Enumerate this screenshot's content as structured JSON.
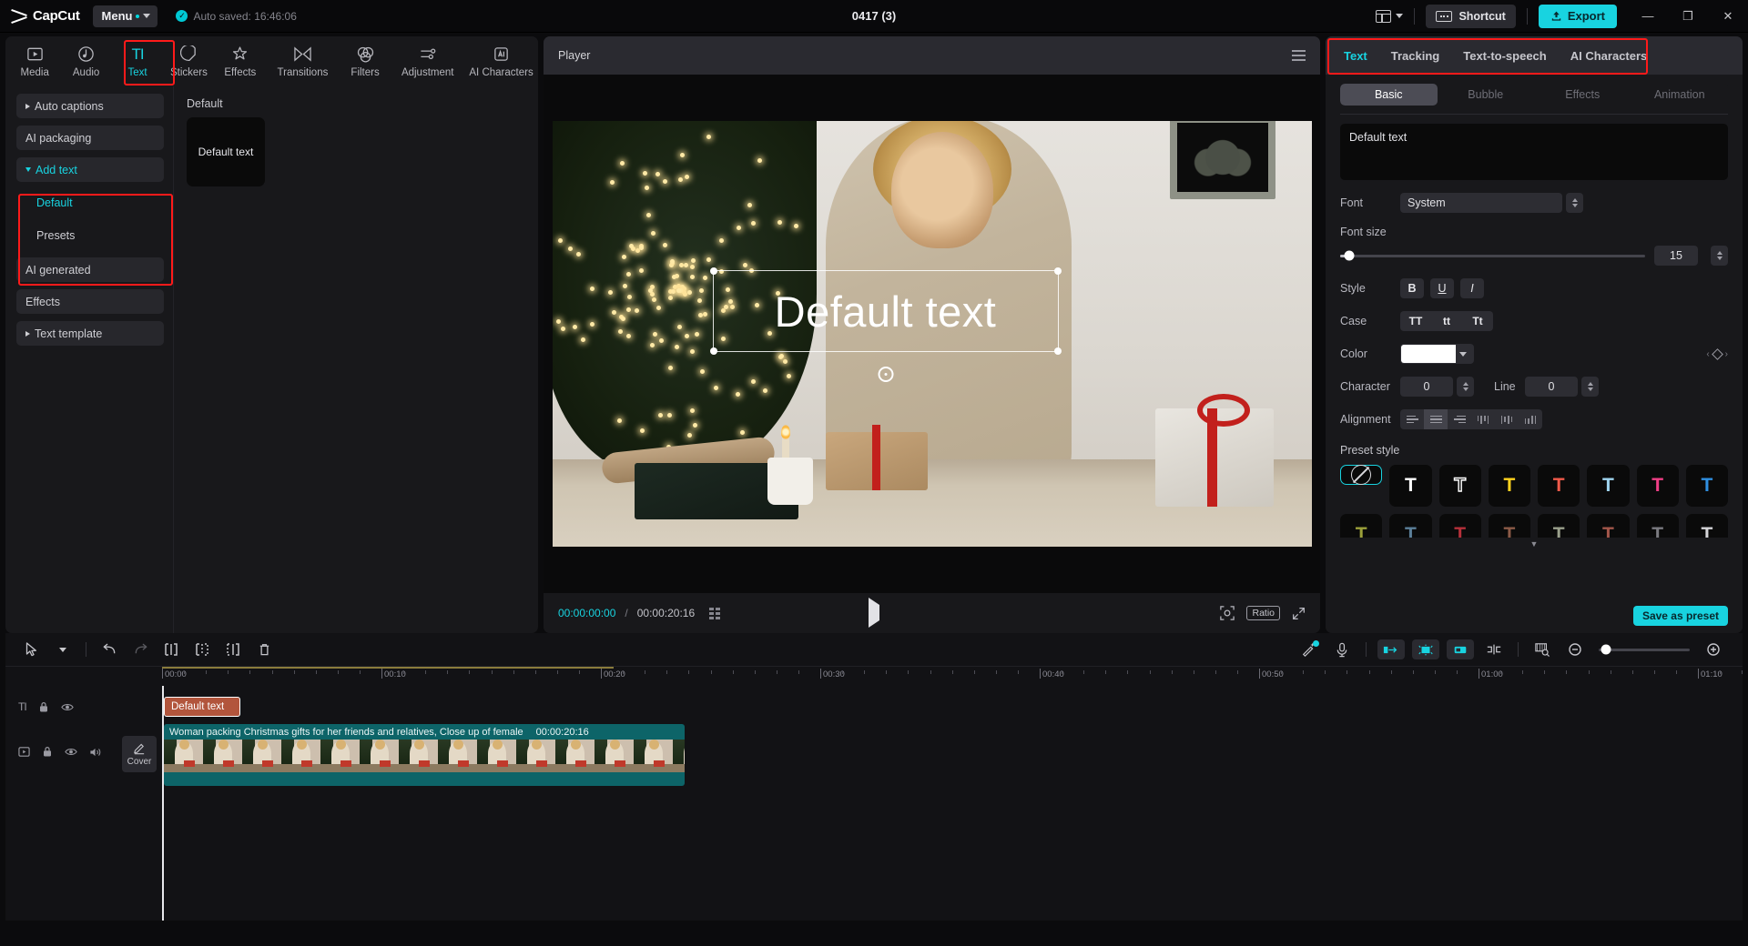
{
  "topbar": {
    "brand": "CapCut",
    "menu_label": "Menu",
    "autosave_text": "Auto saved: 16:46:06",
    "project_title": "0417 (3)",
    "shortcut_label": "Shortcut",
    "export_label": "Export",
    "layout_icon": "layout-icon",
    "minimize_icon": "minimize-icon",
    "maximize_icon": "maximize-icon",
    "close_icon": "close-icon"
  },
  "nav_tabs": [
    {
      "label": "Media",
      "icon": "media-icon",
      "active": false
    },
    {
      "label": "Audio",
      "icon": "audio-icon",
      "active": false
    },
    {
      "label": "Text",
      "icon": "text-icon",
      "active": true
    },
    {
      "label": "Stickers",
      "icon": "stickers-icon",
      "active": false
    },
    {
      "label": "Effects",
      "icon": "effects-icon",
      "active": false
    },
    {
      "label": "Transitions",
      "icon": "transitions-icon",
      "active": false
    },
    {
      "label": "Filters",
      "icon": "filters-icon",
      "active": false
    },
    {
      "label": "Adjustment",
      "icon": "adjustment-icon",
      "active": false
    },
    {
      "label": "AI Characters",
      "icon": "ai-characters-icon",
      "active": false
    }
  ],
  "sidebar": {
    "items": [
      {
        "label": "Auto captions",
        "expandable": true,
        "expanded": false,
        "active": false
      },
      {
        "label": "AI packaging",
        "expandable": false,
        "expanded": false,
        "active": false
      },
      {
        "label": "Add text",
        "expandable": true,
        "expanded": true,
        "active": true
      },
      {
        "label": "AI generated",
        "expandable": false,
        "expanded": false,
        "active": false
      },
      {
        "label": "Effects",
        "expandable": false,
        "expanded": false,
        "active": false
      },
      {
        "label": "Text template",
        "expandable": true,
        "expanded": false,
        "active": false
      }
    ],
    "add_text_children": [
      {
        "label": "Default",
        "active": true
      },
      {
        "label": "Presets",
        "active": false
      }
    ]
  },
  "content_pane": {
    "group_label": "Default",
    "card_label": "Default text"
  },
  "player": {
    "title": "Player",
    "menu_icon": "hamburger-icon",
    "canvas_text": "Default text",
    "current_time": "00:00:00:00",
    "time_separator": "/",
    "total_time": "00:00:20:16",
    "grid_icon": "grid-icon",
    "play_icon": "play-icon",
    "zoom_icon": "zoom-fit-icon",
    "ratio_label": "Ratio",
    "fullscreen_icon": "fullscreen-icon"
  },
  "inspector": {
    "tabs": [
      {
        "label": "Text",
        "active": true
      },
      {
        "label": "Tracking",
        "active": false
      },
      {
        "label": "Text-to-speech",
        "active": false
      },
      {
        "label": "AI Characters",
        "active": false
      }
    ],
    "segments": [
      {
        "label": "Basic",
        "active": true
      },
      {
        "label": "Bubble",
        "active": false
      },
      {
        "label": "Effects",
        "active": false
      },
      {
        "label": "Animation",
        "active": false
      }
    ],
    "textarea_value": "Default text",
    "font_label": "Font",
    "font_value": "System",
    "font_size_label": "Font size",
    "font_size_value": "15",
    "style_label": "Style",
    "style_buttons": [
      "B",
      "U",
      "I"
    ],
    "case_label": "Case",
    "case_buttons": [
      "TT",
      "tt",
      "Tt"
    ],
    "color_label": "Color",
    "color_value": "#ffffff",
    "keyframe_icon": "keyframe-diamond-icon",
    "character_label": "Character",
    "character_value": "0",
    "line_label": "Line",
    "line_value": "0",
    "alignment_label": "Alignment",
    "alignment_options": [
      "align-left-icon",
      "align-center-icon",
      "align-right-icon",
      "vertical-left-icon",
      "vertical-center-icon",
      "vertical-right-icon"
    ],
    "alignment_active_index": 1,
    "preset_style_label": "Preset style",
    "presets": [
      {
        "name": "none",
        "glyph": "ban",
        "color": "#ffffff",
        "selected": true
      },
      {
        "name": "white-solid",
        "glyph": "T",
        "color": "#ffffff",
        "selected": false
      },
      {
        "name": "white-outline",
        "glyph": "T",
        "color": "#111111",
        "outline": "#ffffff",
        "selected": false
      },
      {
        "name": "yellow",
        "glyph": "T",
        "color": "#ffd21e",
        "selected": false
      },
      {
        "name": "red-outline",
        "glyph": "T",
        "color": "#f05a4a",
        "selected": false
      },
      {
        "name": "light-blue",
        "glyph": "T",
        "color": "#9fd4ef",
        "selected": false
      },
      {
        "name": "pink",
        "glyph": "T",
        "color": "#ef3f86",
        "selected": false
      },
      {
        "name": "blue",
        "glyph": "T",
        "color": "#2f8fe0",
        "selected": false
      }
    ],
    "presets_row2": [
      {
        "name": "olive",
        "color": "#9ba03a"
      },
      {
        "name": "steel-blue",
        "color": "#5b7f99"
      },
      {
        "name": "crimson",
        "color": "#b5303a"
      },
      {
        "name": "brown",
        "color": "#8b5a47"
      },
      {
        "name": "sage",
        "color": "#9aa08c"
      },
      {
        "name": "rust",
        "color": "#a3564a"
      },
      {
        "name": "grey",
        "color": "#7a7a80"
      },
      {
        "name": "silver",
        "color": "#d4d4d8"
      }
    ],
    "more_icon": "chevron-down-icon",
    "save_preset_label": "Save as preset"
  },
  "timeline": {
    "tools": [
      {
        "name": "select-tool",
        "icon": "cursor-icon"
      },
      {
        "name": "tool-dropdown",
        "icon": "chevron-down-icon"
      },
      {
        "name": "undo-button",
        "icon": "undo-icon"
      },
      {
        "name": "redo-button",
        "icon": "redo-icon"
      },
      {
        "name": "split-button",
        "icon": "split-icon"
      },
      {
        "name": "trim-left-button",
        "icon": "trim-left-icon"
      },
      {
        "name": "trim-right-button",
        "icon": "trim-right-icon"
      },
      {
        "name": "delete-button",
        "icon": "trash-icon"
      }
    ],
    "right_tools": [
      {
        "name": "magic-tool",
        "icon": "magic-wand-icon",
        "badge": true
      },
      {
        "name": "record-voiceover",
        "icon": "microphone-icon"
      },
      {
        "name": "mix-in",
        "icon": "mix-in-icon"
      },
      {
        "name": "mix-both",
        "icon": "mix-both-icon",
        "active": true
      },
      {
        "name": "mix-out",
        "icon": "mix-out-icon"
      },
      {
        "name": "snap-toggle",
        "icon": "snap-icon"
      },
      {
        "name": "preview-render",
        "icon": "preview-render-icon"
      },
      {
        "name": "zoom-out",
        "icon": "zoom-out-icon"
      },
      {
        "name": "zoom-slider",
        "icon": "slider-icon"
      },
      {
        "name": "zoom-in",
        "icon": "zoom-in-icon"
      }
    ],
    "ruler_labels": [
      "00:00",
      "00:10",
      "00:20",
      "00:30",
      "00:40",
      "00:50",
      "01:00"
    ],
    "playhead_time": "00:00",
    "text_track": {
      "type_icon": "text-track-icon",
      "lock_icon": "lock-icon",
      "eye_icon": "eye-icon",
      "clip_label": "Default text"
    },
    "video_track": {
      "type_icon": "video-track-icon",
      "lock_icon": "lock-icon",
      "eye_icon": "eye-icon",
      "mute_icon": "speaker-icon",
      "cover_label": "Cover",
      "cover_icon": "pencil-icon",
      "clip_label": "Woman packing Christmas gifts for her friends and relatives, Close up of female",
      "clip_duration": "00:00:20:16"
    }
  },
  "highlights": {
    "accent": "#18d3e0",
    "marker": "#ff1a1a"
  }
}
